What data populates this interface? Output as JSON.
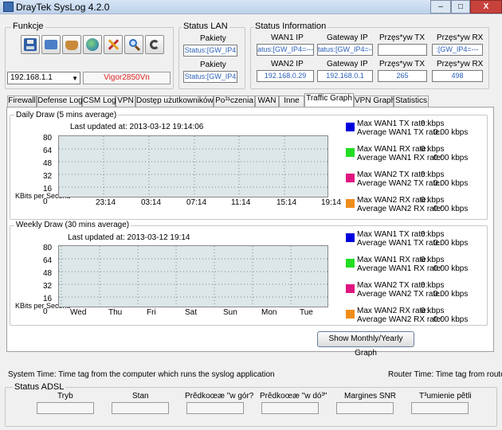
{
  "window": {
    "title": "DrayTek SysLog 4.2.0",
    "min": "–",
    "max": "□",
    "close": "X"
  },
  "functions": {
    "title": "Funkcje",
    "ip_selected": "192.168.1.1",
    "router_name": "Vigor2850Vn"
  },
  "status_lan": {
    "title": "Status LAN",
    "packets_label": "Pakiety",
    "row1": "Status:[GW_IP4",
    "row2": "Status:[GW_IP4"
  },
  "status_info": {
    "title": "Status Information",
    "row1": {
      "wan_label": "WAN1 IP",
      "gw_label": "Gateway IP",
      "tx_label": "Przęs*yw TX",
      "rx_label": "Przęs*yw RX",
      "wan_value": "atus:[GW_IP4=---",
      "gw_value": "tatus:[GW_IP4=---",
      "tx_value": "",
      "rx_value": ":[GW_IP4=---"
    },
    "row2": {
      "wan_label": "WAN2 IP",
      "gw_label": "Gateway IP",
      "tx_label": "Przęs*yw TX",
      "rx_label": "Przęs*yw RX",
      "wan_value": "192.168.0.29",
      "gw_value": "192.168.0.1",
      "tx_value": "265",
      "rx_value": "498"
    }
  },
  "tabs": [
    "Firewall",
    "Defense Log",
    "CSM Log",
    "VPN",
    "Dostęp użutkowników",
    "Po³¹czenia",
    "WAN",
    "Inne",
    "Traffic Graph",
    "VPN Graph",
    "Statistics"
  ],
  "active_tab": "Traffic Graph",
  "daily": {
    "title": "Daily Draw (5 mins average)",
    "updated": "Last updated at: 2013-03-12 19:14:06",
    "y_unit": "KBits per Second",
    "y_ticks": [
      "80",
      "64",
      "48",
      "32",
      "16",
      "0"
    ],
    "x_ticks": [
      "23:14",
      "03:14",
      "07:14",
      "11:14",
      "15:14",
      "19:14"
    ],
    "legend": [
      {
        "color": "#0000dd",
        "line1": "Max WAN1 TX rate:",
        "v1": "0 kbps",
        "line2": "Average WAN1 TX rate:",
        "v2": "0.00 kbps"
      },
      {
        "color": "#22dd22",
        "line1": "Max WAN1 RX rate:",
        "v1": "0 kbps",
        "line2": "Average WAN1 RX rate:",
        "v2": "0.00 kbps"
      },
      {
        "color": "#e0157f",
        "line1": "Max WAN2 TX rate:",
        "v1": "0 kbps",
        "line2": "Average WAN2 TX rate:",
        "v2": "0.00 kbps"
      },
      {
        "color": "#f08c1a",
        "line1": "Max WAN2 RX rate:",
        "v1": "0 kbps",
        "line2": "Average WAN2 RX rate:",
        "v2": "0.00 kbps"
      }
    ]
  },
  "weekly": {
    "title": "Weekly Draw (30 mins average)",
    "updated": "Last updated at: 2013-03-12 19:14",
    "y_unit": "KBits per Second",
    "y_ticks": [
      "80",
      "64",
      "48",
      "32",
      "16",
      "0"
    ],
    "x_ticks": [
      "Wed",
      "Thu",
      "Fri",
      "Sat",
      "Sun",
      "Mon",
      "Tue"
    ],
    "legend": [
      {
        "color": "#0000dd",
        "line1": "Max WAN1 TX rate:",
        "v1": "0 kbps",
        "line2": "Average WAN1 TX rate:",
        "v2": "0.00 kbps"
      },
      {
        "color": "#22dd22",
        "line1": "Max WAN1 RX rate:",
        "v1": "0 kbps",
        "line2": "Average WAN1 RX rate:",
        "v2": "0.00 kbps"
      },
      {
        "color": "#e0157f",
        "line1": "Max WAN2 TX rate:",
        "v1": "0 kbps",
        "line2": "Average WAN2 TX rate:",
        "v2": "0.00 kbps"
      },
      {
        "color": "#f08c1a",
        "line1": "Max WAN2 RX rate:",
        "v1": "0 kbps",
        "line2": "Average WAN2 RX rate:",
        "v2": "0.00 kbps"
      }
    ]
  },
  "monthly_button": "Show Monthly/Yearly Graph",
  "footer": {
    "system_time": "System Time: Time tag from the computer which runs the syslog application",
    "router_time": "Router Time: Time tag from router"
  },
  "adsl": {
    "title": "Status ADSL",
    "columns": [
      "Tryb",
      "Stan",
      "Prêdkoœæ \"w gór?",
      "Prêdkoœæ \"w dó³\"",
      "Margines SNR",
      "T³umienie pêtli"
    ]
  },
  "toolbar_icons": [
    "save-icon",
    "open-folder-icon",
    "basket-icon",
    "globe-icon",
    "tools-icon",
    "search-icon",
    "refresh-icon"
  ]
}
